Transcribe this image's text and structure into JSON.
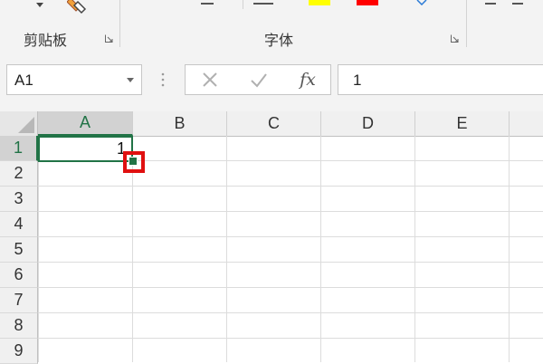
{
  "ribbon": {
    "groups": [
      {
        "label": "剪贴板"
      },
      {
        "label": "字体"
      }
    ],
    "colors": {
      "highlight_swatch": "#ffff00",
      "font_color_swatch": "#ff0000"
    },
    "icons": [
      "dropdown-arrow-icon",
      "format-painter-icon",
      "dialog-launcher-icon",
      "border-icon",
      "underline-icon",
      "phonetic-icon"
    ]
  },
  "formula_bar": {
    "name_box_value": "A1",
    "cancel_icon": "x-icon",
    "enter_icon": "check-icon",
    "fx_label": "fx",
    "content": "1"
  },
  "grid": {
    "column_headers": [
      "A",
      "B",
      "C",
      "D",
      "E"
    ],
    "row_headers": [
      "1",
      "2",
      "3",
      "4",
      "5",
      "6",
      "7",
      "8",
      "9"
    ],
    "active_column": "A",
    "active_row": "1",
    "cells": {
      "A1": "1"
    },
    "selection_color": "#217346",
    "annotation_color": "#e01010"
  }
}
